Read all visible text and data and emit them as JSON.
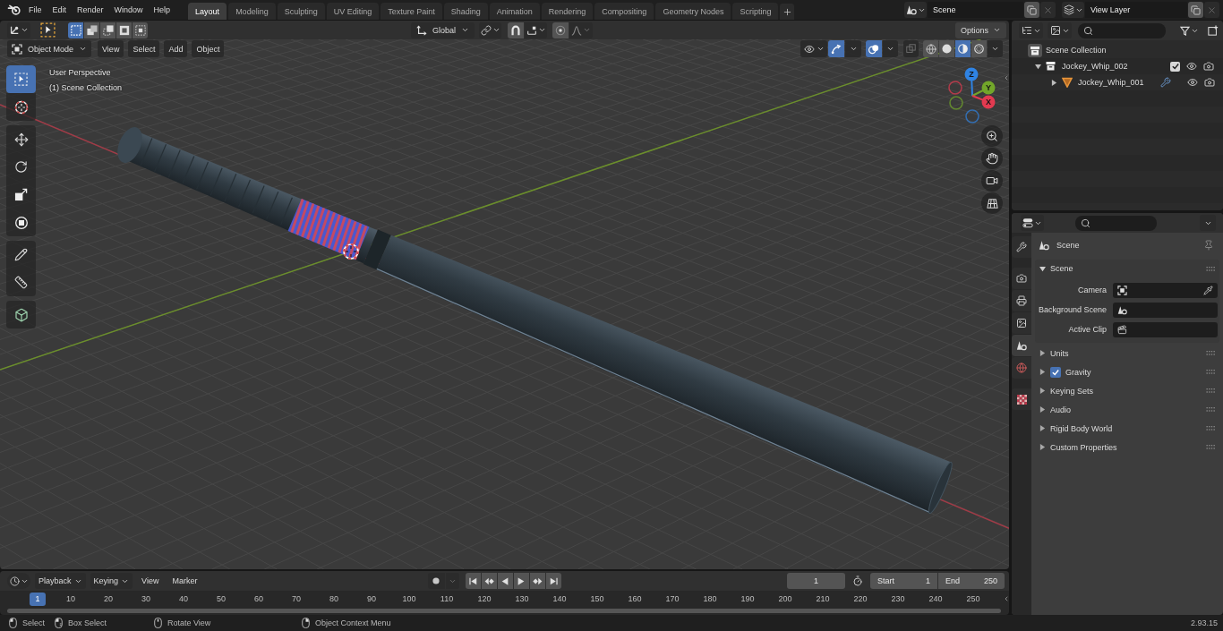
{
  "top_bar": {
    "menus": [
      "File",
      "Edit",
      "Render",
      "Window",
      "Help"
    ],
    "workspace_tabs": [
      {
        "label": "Layout",
        "selected": true
      },
      {
        "label": "Modeling",
        "selected": false
      },
      {
        "label": "Sculpting",
        "selected": false
      },
      {
        "label": "UV Editing",
        "selected": false
      },
      {
        "label": "Texture Paint",
        "selected": false
      },
      {
        "label": "Shading",
        "selected": false
      },
      {
        "label": "Animation",
        "selected": false
      },
      {
        "label": "Rendering",
        "selected": false
      },
      {
        "label": "Compositing",
        "selected": false
      },
      {
        "label": "Geometry Nodes",
        "selected": false
      },
      {
        "label": "Scripting",
        "selected": false
      }
    ],
    "scene": "Scene",
    "view_layer": "View Layer"
  },
  "tool_settings": {
    "select_modes": [
      {
        "kind": "set",
        "selected": true
      },
      {
        "kind": "extend",
        "selected": false
      },
      {
        "kind": "subtract",
        "selected": false
      },
      {
        "kind": "invert",
        "selected": false
      },
      {
        "kind": "intersect",
        "selected": false
      }
    ],
    "orientation": "Global",
    "snap": false,
    "proportional": false,
    "options": "Options"
  },
  "viewport": {
    "mode": "Object Mode",
    "menus": [
      "View",
      "Select",
      "Add",
      "Object"
    ],
    "gizmos": true,
    "overlays": true,
    "xray": false,
    "shading": [
      {
        "kind": "wireframe",
        "selected": false
      },
      {
        "kind": "solid",
        "selected": false
      },
      {
        "kind": "material",
        "selected": true
      },
      {
        "kind": "rendered",
        "selected": false
      }
    ],
    "info": [
      "User Perspective",
      "(1) Scene Collection"
    ],
    "tool_groups": [
      {
        "tools": [
          {
            "kind": "select_box",
            "selected": true
          },
          {
            "kind": "cursor",
            "selected": false
          }
        ]
      },
      {
        "tools": [
          {
            "kind": "move",
            "selected": false
          },
          {
            "kind": "rotate",
            "selected": false
          },
          {
            "kind": "scale",
            "selected": false
          },
          {
            "kind": "transform",
            "selected": false
          }
        ]
      },
      {
        "tools": [
          {
            "kind": "annotate",
            "selected": false
          },
          {
            "kind": "measure",
            "selected": false
          }
        ]
      },
      {
        "tools": [
          {
            "kind": "add_cube",
            "selected": false
          }
        ]
      }
    ],
    "gizmo": [
      {
        "label": "Z",
        "color": "#2f83e3"
      },
      {
        "label": "Y",
        "color": "#72a62a"
      },
      {
        "label": "X",
        "color": "#e23a50"
      }
    ]
  },
  "outliner": {
    "tree": [
      {
        "label": "Scene Collection",
        "kind": "scene_collection",
        "children": [
          {
            "label": "Jockey_Whip_002",
            "kind": "collection",
            "expanded": true,
            "checked": true,
            "visible": true,
            "renderable": true,
            "children": [
              {
                "label": "Jockey_Whip_001",
                "kind": "mesh",
                "expanded": false,
                "modifier": true,
                "visible": true,
                "renderable": true
              }
            ]
          }
        ]
      }
    ]
  },
  "properties": {
    "tab_groups": [
      {
        "tabs": [
          {
            "kind": "tool",
            "selected": false
          }
        ]
      },
      {
        "tabs": [
          {
            "kind": "render",
            "selected": false
          },
          {
            "kind": "output",
            "selected": false
          },
          {
            "kind": "view_layer",
            "selected": false
          },
          {
            "kind": "scene",
            "selected": true
          },
          {
            "kind": "world",
            "selected": false
          }
        ]
      },
      {
        "tabs": [
          {
            "kind": "texture",
            "selected": false
          }
        ]
      }
    ],
    "context": "Scene",
    "panel": {
      "title": "Scene",
      "expanded": true,
      "fields": [
        {
          "label": "Camera",
          "kind": "camera"
        },
        {
          "label": "Background Scene",
          "kind": "scene"
        },
        {
          "label": "Active Clip",
          "kind": "clip"
        }
      ]
    },
    "subpanels": [
      {
        "title": "Units",
        "expanded": false
      },
      {
        "title": "Gravity",
        "expanded": false,
        "toggle": {
          "checked": true
        }
      },
      {
        "title": "Keying Sets",
        "expanded": false
      },
      {
        "title": "Audio",
        "expanded": false
      },
      {
        "title": "Rigid Body World",
        "expanded": false
      },
      {
        "title": "Custom Properties",
        "expanded": false
      }
    ]
  },
  "timeline": {
    "menus": [
      {
        "label": "Playback",
        "kind": "dropdown"
      },
      {
        "label": "Keying",
        "kind": "dropdown"
      },
      {
        "label": "View",
        "kind": "menu"
      },
      {
        "label": "Marker",
        "kind": "menu"
      }
    ],
    "auto_keying": false,
    "frame": "1",
    "start": {
      "label": "Start",
      "value": "1"
    },
    "end": {
      "label": "End",
      "value": "250"
    },
    "current_frame": "1",
    "ruler": [
      "10",
      "20",
      "30",
      "40",
      "50",
      "60",
      "70",
      "80",
      "90",
      "100",
      "110",
      "120",
      "130",
      "140",
      "150",
      "160",
      "170",
      "180",
      "190",
      "200",
      "210",
      "220",
      "230",
      "240",
      "250"
    ]
  },
  "status_bar": {
    "hints": [
      {
        "kind": "left",
        "label": "Select"
      },
      {
        "kind": "left_drag",
        "label": "Box Select"
      },
      {
        "kind": "middle",
        "label": "Rotate View"
      },
      {
        "kind": "right",
        "label": "Object Context Menu"
      }
    ],
    "version": "2.93.15"
  }
}
